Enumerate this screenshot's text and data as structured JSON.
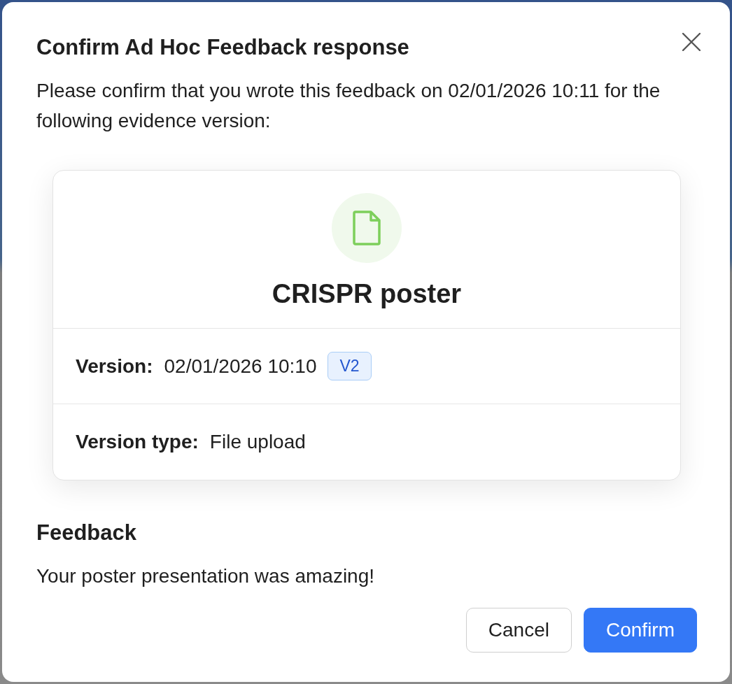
{
  "dialog": {
    "title": "Confirm Ad Hoc Feedback response",
    "message": "Please confirm that you wrote this feedback on 02/01/2026 10:11 for the following evidence version:"
  },
  "evidence": {
    "name": "CRISPR poster",
    "fields": [
      {
        "label": "Version:",
        "value": "02/01/2026 10:10",
        "badge": "V2"
      },
      {
        "label": "Version type:",
        "value": "File upload"
      }
    ]
  },
  "feedback": {
    "heading": "Feedback",
    "text": "Your poster presentation was amazing!"
  },
  "buttons": [
    {
      "label": "Cancel",
      "kind": "secondary"
    },
    {
      "label": "Confirm",
      "kind": "primary"
    }
  ]
}
